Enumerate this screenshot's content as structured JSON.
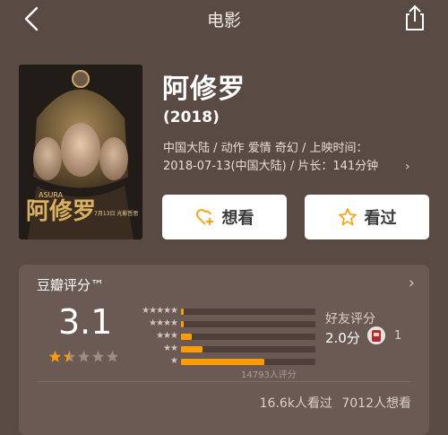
{
  "header": {
    "title": "电影"
  },
  "movie": {
    "title": "阿修罗",
    "year": "(2018)",
    "meta_line1": "中国大陆 / 动作 爱情 奇幻 / 上映时间：",
    "meta_line2": "2018-07-13(中国大陆) / 片长：141分钟",
    "poster_title": "阿修罗",
    "poster_en": "ASURA",
    "poster_date": "7月13日 光影哲思"
  },
  "actions": {
    "want_label": "想看",
    "seen_label": "看过"
  },
  "rating": {
    "label": "豆瓣评分™",
    "score": "3.1",
    "star_fill": 1.5,
    "votes": "14793人评分",
    "distribution": [
      {
        "stars": "★★★★★",
        "fraction": 0.02
      },
      {
        "stars": "★★★★",
        "fraction": 0.02
      },
      {
        "stars": "★★★",
        "fraction": 0.08
      },
      {
        "stars": "★★",
        "fraction": 0.16
      },
      {
        "stars": "★",
        "fraction": 0.62
      }
    ],
    "bar_color": "#ff9d00"
  },
  "friends": {
    "label": "好友评分",
    "score": "2.0分",
    "count": "1"
  },
  "stats": {
    "text": "16.6k人看过   7012人想看"
  }
}
